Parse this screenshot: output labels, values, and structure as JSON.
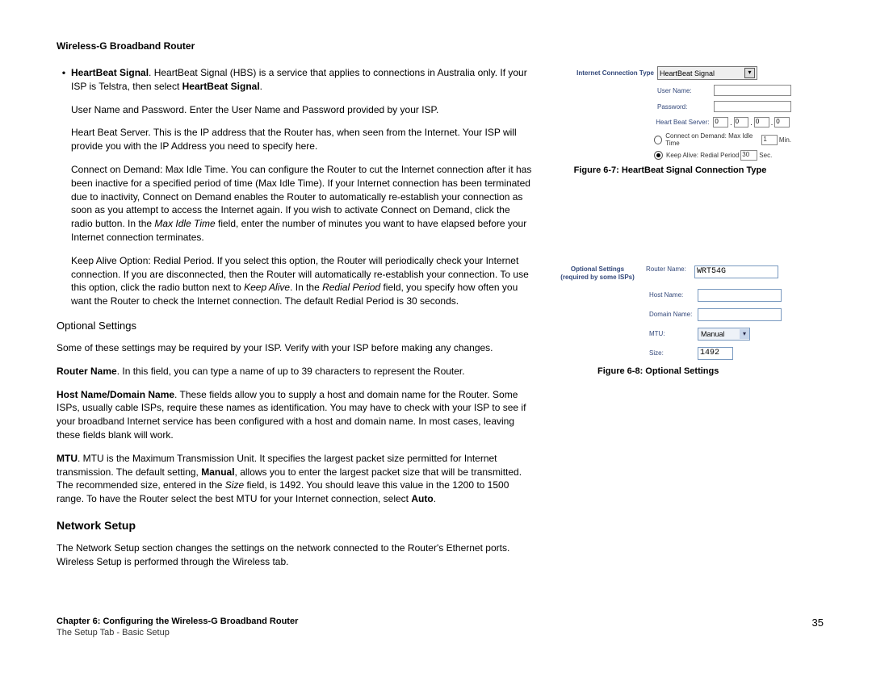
{
  "header": {
    "title": "Wireless-G Broadband Router"
  },
  "footer": {
    "line1": "Chapter 6: Configuring the Wireless-G Broadband Router",
    "line2": "The Setup Tab - Basic Setup",
    "page_num": "35"
  },
  "body": {
    "bullet_lead_bold": "HeartBeat Signal",
    "bullet_lead_rest": ". HeartBeat Signal (HBS) is a service that applies to connections in Australia only. If your ISP is Telstra, then select ",
    "bullet_lead_bold2": "HeartBeat Signal",
    "bullet_lead_end": ".",
    "p1": "User Name and Password. Enter the User Name and Password provided by your ISP.",
    "p2": "Heart Beat Server. This is the IP address that the Router has, when seen from the Internet. Your ISP will provide you with the IP Address you need to specify here.",
    "p3a": "Connect on Demand: Max Idle Time. You can configure the Router to cut the Internet connection after it has been inactive for a specified period of time (Max Idle Time). If your Internet connection has been terminated due to inactivity, Connect on Demand enables the Router to automatically re-establish your connection as soon as you attempt to access the Internet again. If you wish to activate Connect on Demand, click the radio button. In the ",
    "p3i": "Max Idle Time",
    "p3b": " field, enter the number of minutes you want to have elapsed before your Internet connection terminates.",
    "p4a": "Keep Alive Option: Redial Period. If you select this option, the Router will periodically check your Internet connection. If you are disconnected, then the Router will automatically re-establish your connection. To use this option, click the radio button next to ",
    "p4i1": "Keep Alive",
    "p4b": ". In the ",
    "p4i2": "Redial Period",
    "p4c": " field, you specify how often you want the Router to check the Internet connection. The default Redial Period is 30 seconds.",
    "sub_optional": "Optional Settings",
    "p5": "Some of these settings may be required by your ISP. Verify with your ISP before making any changes.",
    "p6b": "Router Name",
    "p6r": ". In this field, you can type a name of up to 39 characters to represent the Router.",
    "p7b": "Host Name/Domain Name",
    "p7r": ". These fields allow you to supply a host and domain name for the Router. Some ISPs, usually cable ISPs, require these names as identification. You may have to check with your ISP to see if your broadband Internet service has been configured with a host and domain name. In most cases, leaving these fields blank will work.",
    "p8b": "MTU",
    "p8r1": ". MTU is the Maximum Transmission Unit. It specifies the largest packet size permitted for Internet transmission. The default setting, ",
    "p8b2": "Manual",
    "p8r2": ", allows you to enter the largest packet size that will be transmitted. The recommended size, entered in the ",
    "p8i": "Size",
    "p8r3": " field, is 1492. You should leave this value in the 1200 to 1500 range. To have the Router select the best MTU for your Internet connection, select ",
    "p8b3": "Auto",
    "p8r4": ".",
    "sec_network": "Network Setup",
    "p9": "The Network Setup section changes the settings on the network connected to the Router's Ethernet ports. Wireless Setup is performed through the Wireless tab."
  },
  "fig67": {
    "caption": "Figure 6-7: HeartBeat Signal Connection Type",
    "section_label": "Internet Connection Type",
    "dropdown_value": "HeartBeat Signal",
    "user_name_label": "User Name:",
    "password_label": "Password:",
    "hbs_label": "Heart Beat Server:",
    "ip": [
      "0",
      "0",
      "0",
      "0"
    ],
    "cod_label": "Connect on Demand: Max Idle Time",
    "cod_value": "1",
    "cod_unit": "Min.",
    "ka_label": "Keep Alive: Redial Period",
    "ka_value": "30",
    "ka_unit": "Sec."
  },
  "fig68": {
    "caption": "Figure 6-8: Optional Settings",
    "side_label_l1": "Optional Settings",
    "side_label_l2": "(required by some ISPs)",
    "router_name_label": "Router Name:",
    "router_name_value": "WRT54G",
    "host_name_label": "Host Name:",
    "domain_name_label": "Domain Name:",
    "mtu_label": "MTU:",
    "mtu_value": "Manual",
    "size_label": "Size:",
    "size_value": "1492"
  }
}
